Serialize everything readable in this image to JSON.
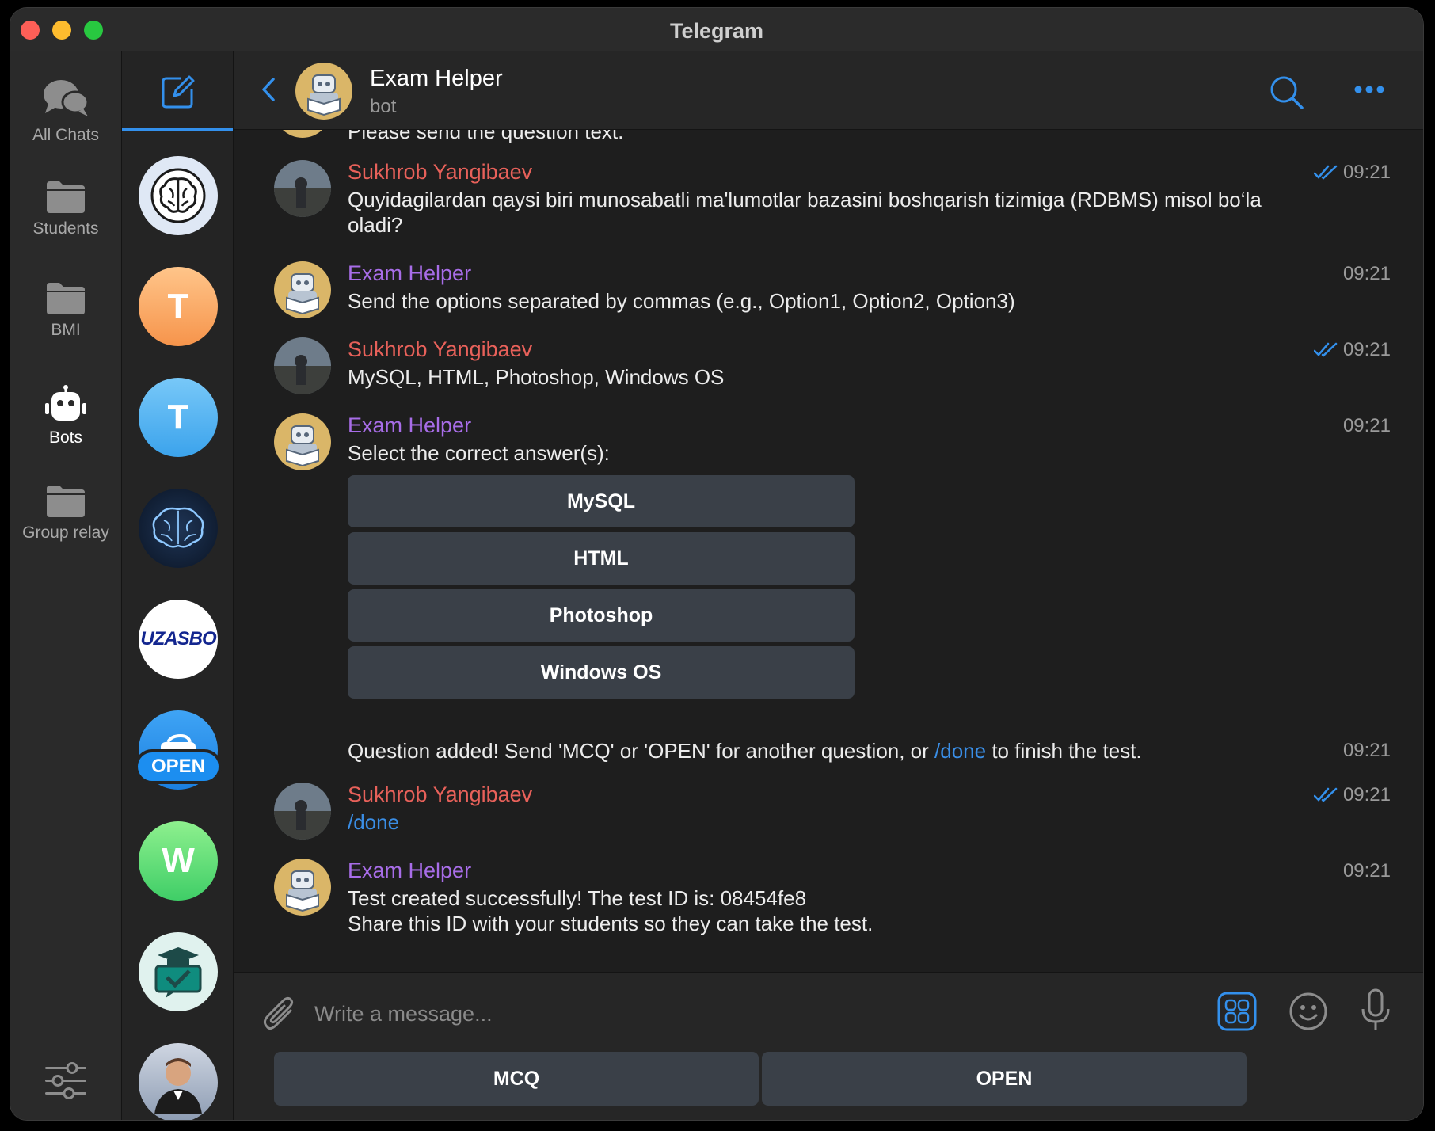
{
  "window": {
    "title": "Telegram"
  },
  "folders": [
    {
      "label": "All Chats",
      "icon": "chat-bubbles-icon"
    },
    {
      "label": "Students",
      "icon": "folder-icon"
    },
    {
      "label": "BMI",
      "icon": "folder-icon"
    },
    {
      "label": "Bots",
      "icon": "robot-icon",
      "active": true
    },
    {
      "label": "Group relay",
      "icon": "folder-icon"
    }
  ],
  "chatlist": {
    "letters": {
      "t1": "T",
      "t2": "T",
      "w": "W"
    },
    "open_badge": "OPEN",
    "uzasbo_logo_text": "UZASBO"
  },
  "header": {
    "name": "Exam Helper",
    "status": "bot"
  },
  "messages": {
    "partial_text": "Please send the question text.",
    "m1": {
      "sender": "Sukhrob Yangibaev",
      "time": "09:21",
      "text": "Quyidagilardan qaysi biri munosabatli ma'lumotlar bazasini boshqarish tizimiga (RDBMS) misol bo‘la oladi?"
    },
    "m2": {
      "sender": "Exam Helper",
      "time": "09:21",
      "text": "Send the options separated by commas (e.g., Option1, Option2, Option3)"
    },
    "m3": {
      "sender": "Sukhrob Yangibaev",
      "time": "09:21",
      "text": "MySQL, HTML, Photoshop, Windows OS"
    },
    "m4": {
      "sender": "Exam Helper",
      "time": "09:21",
      "text": "Select the correct answer(s):",
      "buttons": [
        "MySQL",
        "HTML",
        "Photoshop",
        "Windows OS"
      ]
    },
    "m5": {
      "time": "09:21",
      "text_before": "Question added! Send 'MCQ' or 'OPEN' for another question, or ",
      "link": "/done",
      "text_after": " to finish the test."
    },
    "m6": {
      "sender": "Sukhrob Yangibaev",
      "time": "09:21",
      "text": "/done"
    },
    "m7": {
      "sender": "Exam Helper",
      "time": "09:21",
      "line1": "Test created successfully! The test ID is: 08454fe8",
      "line2": "Share this ID with your students so they can take the test."
    }
  },
  "composer": {
    "placeholder": "Write a message..."
  },
  "reply_keyboard": [
    "MCQ",
    "OPEN"
  ],
  "colors": {
    "accent": "#3390ec",
    "user_name": "#e8615a",
    "bot_name": "#a86de8",
    "button_bg": "#3a4048"
  }
}
